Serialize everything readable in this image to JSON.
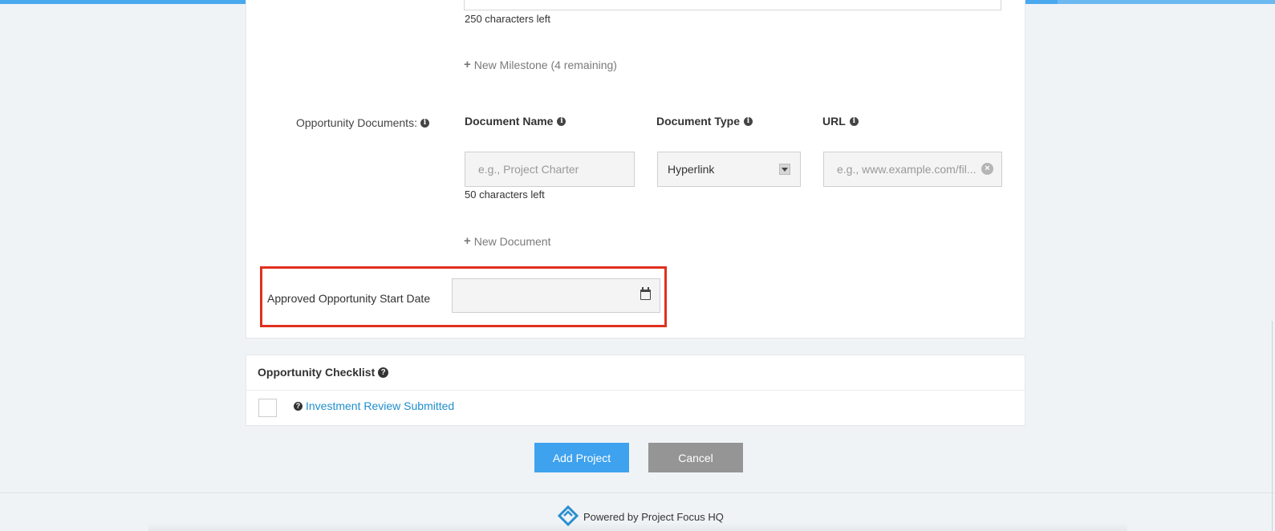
{
  "milestones": {
    "description_chars_left": "250 characters left",
    "new_milestone_link": "New Milestone (4 remaining)"
  },
  "documents": {
    "section_label": "Opportunity Documents:",
    "col_name": "Document Name",
    "col_type": "Document Type",
    "col_url": "URL",
    "name_placeholder": "e.g., Project Charter",
    "name_chars_left": "50 characters left",
    "type_value": "Hyperlink",
    "url_placeholder": "e.g., www.example.com/fil...",
    "new_document_link": "New Document"
  },
  "start_date": {
    "label": "Approved Opportunity Start Date",
    "value": ""
  },
  "checklist": {
    "title": "Opportunity Checklist",
    "items": [
      {
        "label": "Investment Review Submitted",
        "checked": false
      }
    ]
  },
  "actions": {
    "add_label": "Add Project",
    "cancel_label": "Cancel"
  },
  "footer": {
    "text": "Powered by Project Focus HQ"
  },
  "colors": {
    "accent": "#3ea2ee",
    "highlight": "#e0301e",
    "link": "#1f8fce",
    "cancel": "#959595"
  },
  "icons": [
    "info-icon",
    "plus-icon",
    "caret-down-icon",
    "clear-icon",
    "calendar-icon",
    "help-icon",
    "logo-icon"
  ]
}
